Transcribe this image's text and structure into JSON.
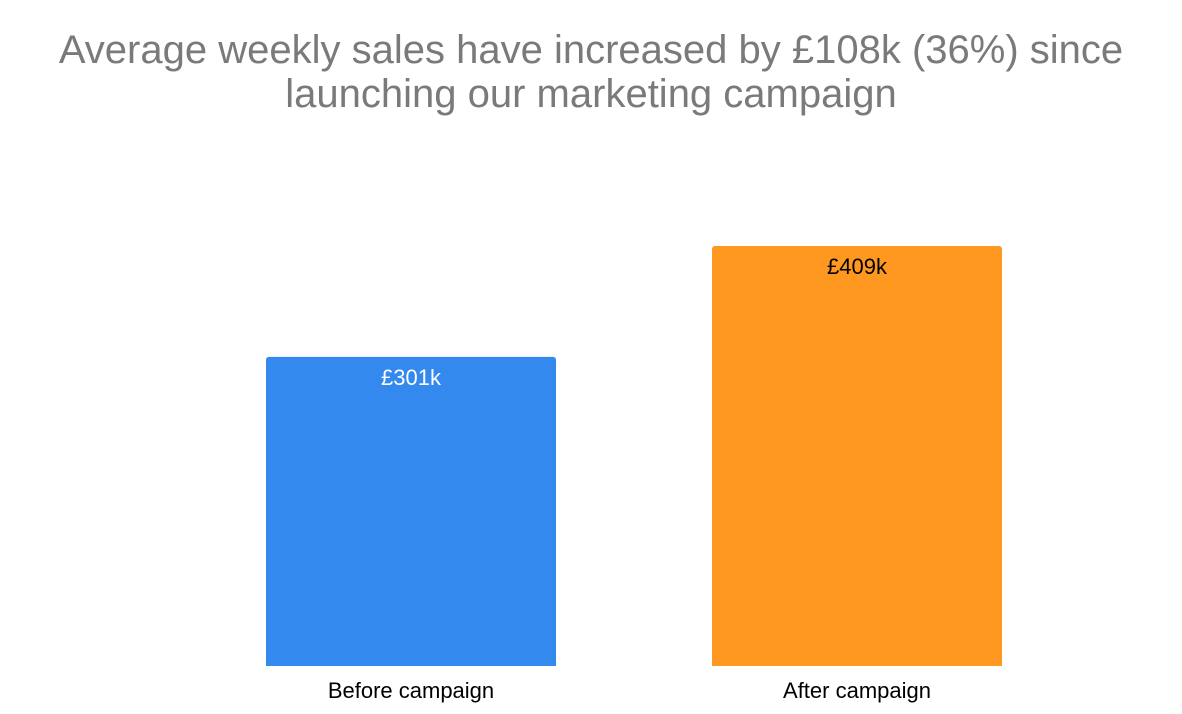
{
  "chart_data": {
    "type": "bar",
    "title_lines": [
      "Average weekly sales have increased by £108k (36%) since",
      "launching our marketing campaign"
    ],
    "categories": [
      "Before campaign",
      "After campaign"
    ],
    "values": [
      301,
      409
    ],
    "data_labels": [
      "£301k",
      "£409k"
    ],
    "bar_colors": [
      "#3389EE",
      "#FF9821"
    ],
    "data_label_colors": [
      "#ffffff",
      "#000000"
    ],
    "xlabel": "",
    "ylabel": "",
    "ylim": [
      0,
      409
    ],
    "grid": false,
    "legend": "none"
  }
}
